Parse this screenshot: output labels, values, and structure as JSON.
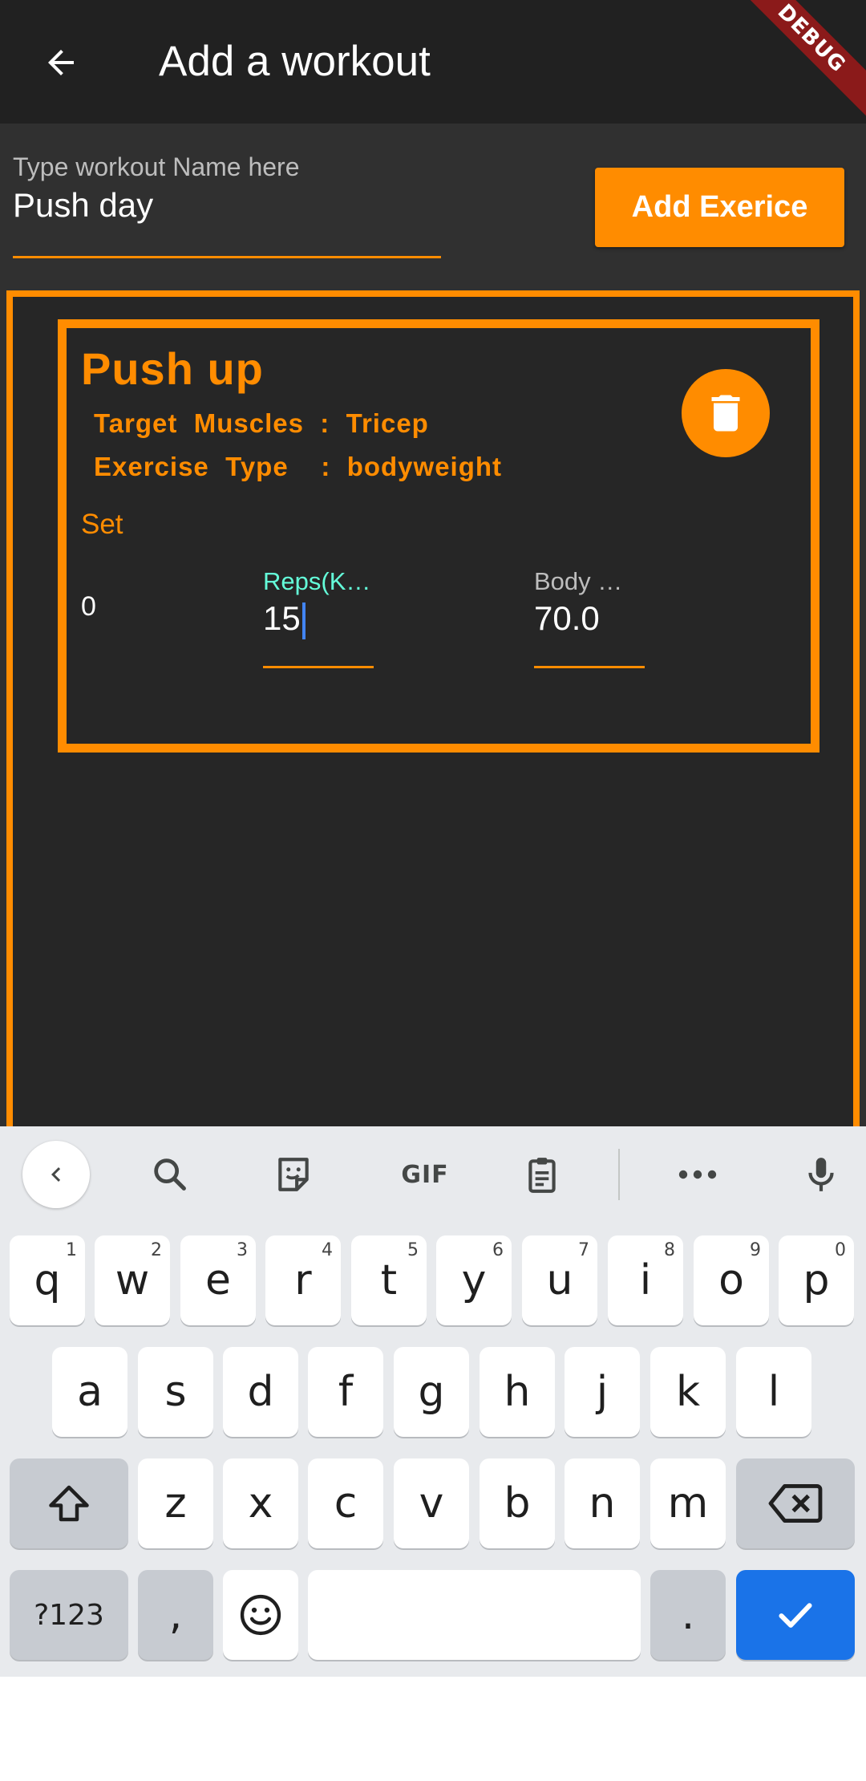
{
  "appbar": {
    "title": "Add a workout",
    "back_icon": "arrow-left-icon",
    "debug_banner": "DEBUG"
  },
  "form": {
    "name_label": "Type workout Name here",
    "name_value": "Push day",
    "add_button": "Add Exerice"
  },
  "exercise": {
    "name": "Push up",
    "target_muscles_line": "Target  Muscles  :  Tricep",
    "exercise_type_line": "Exercise  Type    :  bodyweight",
    "delete_icon": "trash-icon",
    "set_label": "Set",
    "set_number": "0",
    "reps_label": "Reps(K…",
    "reps_value": "15",
    "weight_label": "Body …",
    "weight_value": "70.0"
  },
  "keyboard": {
    "toolbar": [
      "chevron-left-icon",
      "search-icon",
      "sticker-icon",
      "GIF",
      "clipboard-icon",
      "more-icon",
      "mic-icon"
    ],
    "gif_label": "GIF",
    "row1": [
      {
        "k": "q",
        "h": "1"
      },
      {
        "k": "w",
        "h": "2"
      },
      {
        "k": "e",
        "h": "3"
      },
      {
        "k": "r",
        "h": "4"
      },
      {
        "k": "t",
        "h": "5"
      },
      {
        "k": "y",
        "h": "6"
      },
      {
        "k": "u",
        "h": "7"
      },
      {
        "k": "i",
        "h": "8"
      },
      {
        "k": "o",
        "h": "9"
      },
      {
        "k": "p",
        "h": "0"
      }
    ],
    "row2": [
      "a",
      "s",
      "d",
      "f",
      "g",
      "h",
      "j",
      "k",
      "l"
    ],
    "row3": [
      "z",
      "x",
      "c",
      "v",
      "b",
      "n",
      "m"
    ],
    "symbols_key": "?123",
    "comma_key": ",",
    "period_key": ".",
    "accent_color": "#1a73e8",
    "brand_color": "#ff8c00"
  }
}
